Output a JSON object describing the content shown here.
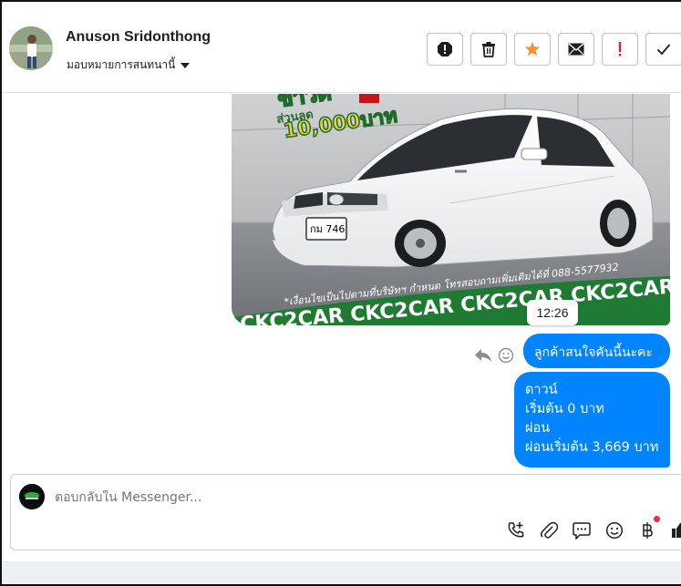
{
  "header": {
    "contact_name": "Anuson Sridonthong",
    "assign_label": "มอบหมายการสนทนานี้",
    "actions": [
      {
        "name": "spam-icon",
        "color": "#1c1e21"
      },
      {
        "name": "trash-icon",
        "color": "#1c1e21"
      },
      {
        "name": "star-icon",
        "color": "#f7923a"
      },
      {
        "name": "envelope-icon",
        "color": "#1c1e21"
      },
      {
        "name": "exclamation-icon",
        "color": "#e41e3f"
      },
      {
        "name": "checkmark-icon",
        "color": "#1c1e21"
      }
    ]
  },
  "chat": {
    "image_banner": {
      "discount_label": "ส่วนลด",
      "discount_amount": "10,000บาท",
      "plate_text": "กม 746",
      "disclaimer": "*เงื่อนไขเป็นไปตามที่บริษัทฯ กำหนด โทรสอบถามเพิ่มเติมได้ที่ 088-5577932",
      "watermark": "CKC2CAR CKC2CAR CKC2CAR CKC2CAR CKC2CAR CKC2"
    },
    "timestamp": "12:26",
    "messages": {
      "msg1": "ลูกค้าสนใจคันนี้นะคะ",
      "msg2_line1": "ดาวน์",
      "msg2_line2": "เริ่มต้น 0 บาท",
      "msg2_line3": "ผ่อน",
      "msg2_line4": "ผ่อนเริ่มต้น 3,669 บาท"
    },
    "bubble_color": "#0084ff"
  },
  "composer": {
    "placeholder": "ตอบกลับใน Messenger...",
    "tools": [
      "phone-plus-icon",
      "paperclip-icon",
      "saved-reply-icon",
      "emoji-icon",
      "baht-icon",
      "thumbs-up-icon"
    ]
  }
}
